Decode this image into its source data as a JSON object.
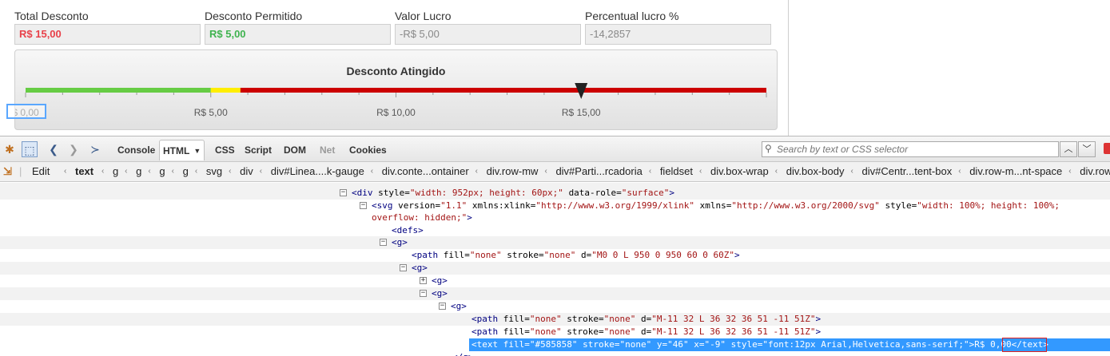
{
  "form": {
    "fields": [
      {
        "label": "Total Desconto",
        "value": "R$ 15,00"
      },
      {
        "label": "Desconto Permitido",
        "value": "R$ 5,00"
      },
      {
        "label": "Valor Lucro",
        "value": "-R$ 5,00"
      },
      {
        "label": "Percentual lucro %",
        "value": "-14,2857"
      }
    ]
  },
  "gauge": {
    "title": "Desconto Atingido",
    "min": 0,
    "max": 20,
    "tick_labels": [
      {
        "value": 0,
        "label": "$ 0,00"
      },
      {
        "value": 5,
        "label": "R$ 5,00"
      },
      {
        "value": 10,
        "label": "R$ 10,00"
      },
      {
        "value": 15,
        "label": "R$ 15,00"
      }
    ],
    "ranges": [
      {
        "from": 0,
        "to": 5,
        "color": "#66cc44"
      },
      {
        "from": 5,
        "to": 5.8,
        "color": "#ffee00"
      },
      {
        "from": 5.8,
        "to": 20,
        "color": "#cc0000"
      }
    ],
    "pointer_value": 15,
    "pointer_color": "#222222",
    "colors": {
      "red_text": "#e8414a",
      "green_text": "#3fb34f",
      "focus": "#5aa7ff"
    }
  },
  "devtools": {
    "tabs": [
      "Console",
      "HTML",
      "CSS",
      "Script",
      "DOM",
      "Net",
      "Cookies"
    ],
    "active_tab": "HTML",
    "search_placeholder": "Search by text or CSS selector",
    "edit_label": "Edit",
    "breadcrumb": [
      "text",
      "g",
      "g",
      "g",
      "g",
      "svg",
      "div",
      "div#Linea....k-gauge",
      "div.conte...ontainer",
      "div.row-mw",
      "div#Parti...rcadoria",
      "fieldset",
      "div.box-wrap",
      "div.box-body",
      "div#Centr...tent-box",
      "div.row-m...nt-space",
      "div.row-u"
    ],
    "selected_text": "R$ 0,00",
    "accent": "#3399ff"
  }
}
